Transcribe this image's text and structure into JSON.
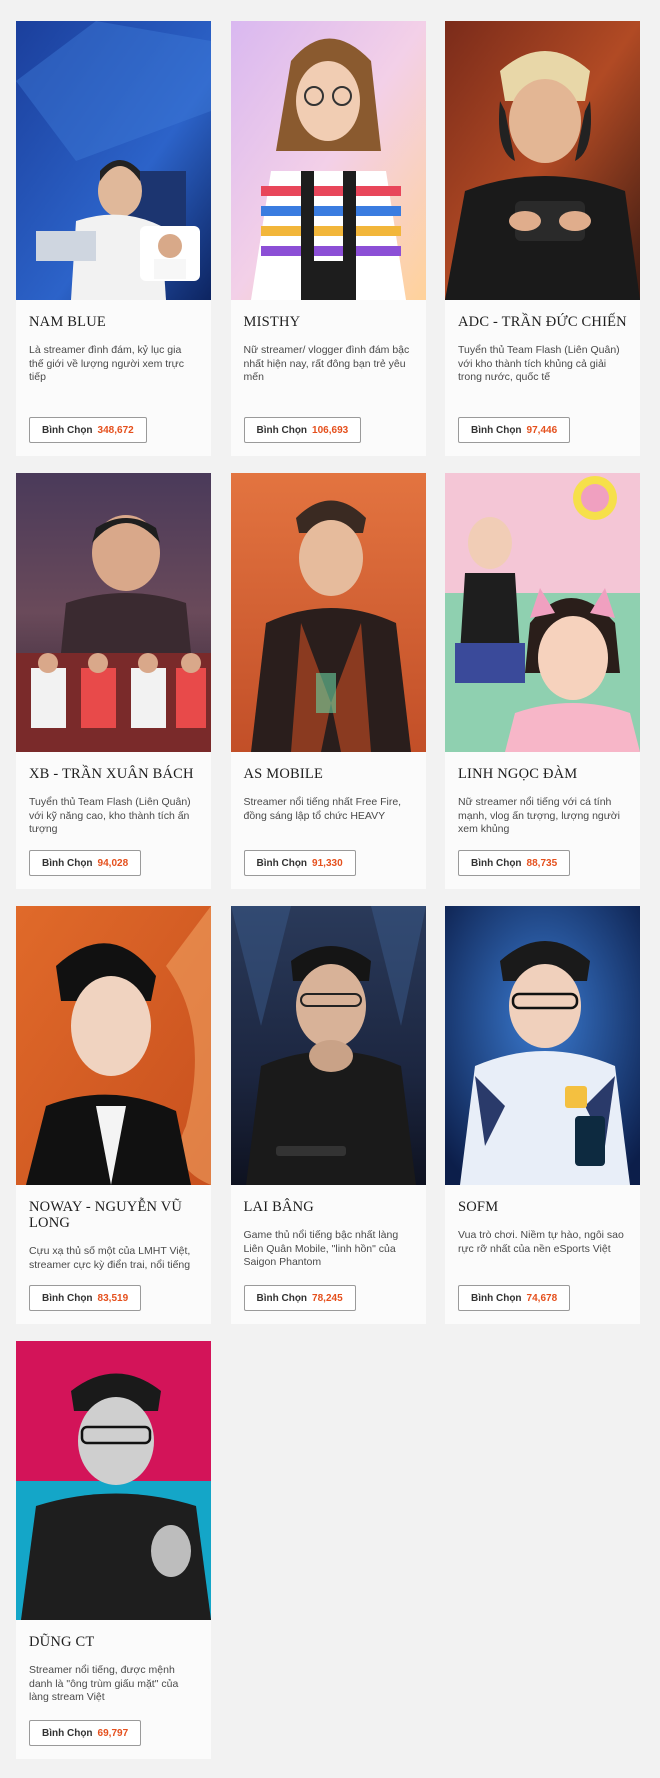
{
  "vote_label": "Bình Chọn",
  "accent_color": "#e5501d",
  "cards": [
    {
      "name": "NAM BLUE",
      "desc": "Là streamer đình đám, kỷ lục gia thế giới về lượng người xem trực tiếp",
      "votes": "348,672"
    },
    {
      "name": "MISTHY",
      "desc": "Nữ streamer/ vlogger đình đám bậc nhất hiện nay, rất đông bạn trẻ yêu mến",
      "votes": "106,693"
    },
    {
      "name": "ADC - TRẦN ĐỨC CHIẾN",
      "desc": "Tuyển thủ Team Flash (Liên Quân) với kho thành tích khủng cả giải trong nước, quốc tế",
      "votes": "97,446"
    },
    {
      "name": "XB - TRẦN XUÂN BÁCH",
      "desc": "Tuyển thủ Team Flash (Liên Quân) với kỹ năng cao, kho thành tích ấn tượng",
      "votes": "94,028"
    },
    {
      "name": "AS MOBILE",
      "desc": "Streamer nổi tiếng nhất Free Fire, đồng sáng lập tổ chức HEAVY",
      "votes": "91,330"
    },
    {
      "name": "LINH NGỌC ĐÀM",
      "desc": "Nữ streamer nổi tiếng với cá tính mạnh, vlog ấn tượng, lượng người xem khủng",
      "votes": "88,735"
    },
    {
      "name": "NOWAY - NGUYỄN VŨ LONG",
      "desc": "Cựu xạ thủ số một của LMHT Việt, streamer cực kỳ điển trai, nổi tiếng",
      "votes": "83,519"
    },
    {
      "name": "LAI BÂNG",
      "desc": "Game thủ nổi tiếng bậc nhất làng Liên Quân Mobile, \"linh hồn\" của Saigon Phantom",
      "votes": "78,245"
    },
    {
      "name": "SOFM",
      "desc": "Vua trò chơi. Niềm tự hào, ngôi sao rực rỡ nhất của nền eSports Việt",
      "votes": "74,678"
    },
    {
      "name": "DŨNG CT",
      "desc": "Streamer nổi tiếng, được mệnh danh là \"ông trùm giấu mặt\" của làng stream Việt",
      "votes": "69,797"
    }
  ]
}
